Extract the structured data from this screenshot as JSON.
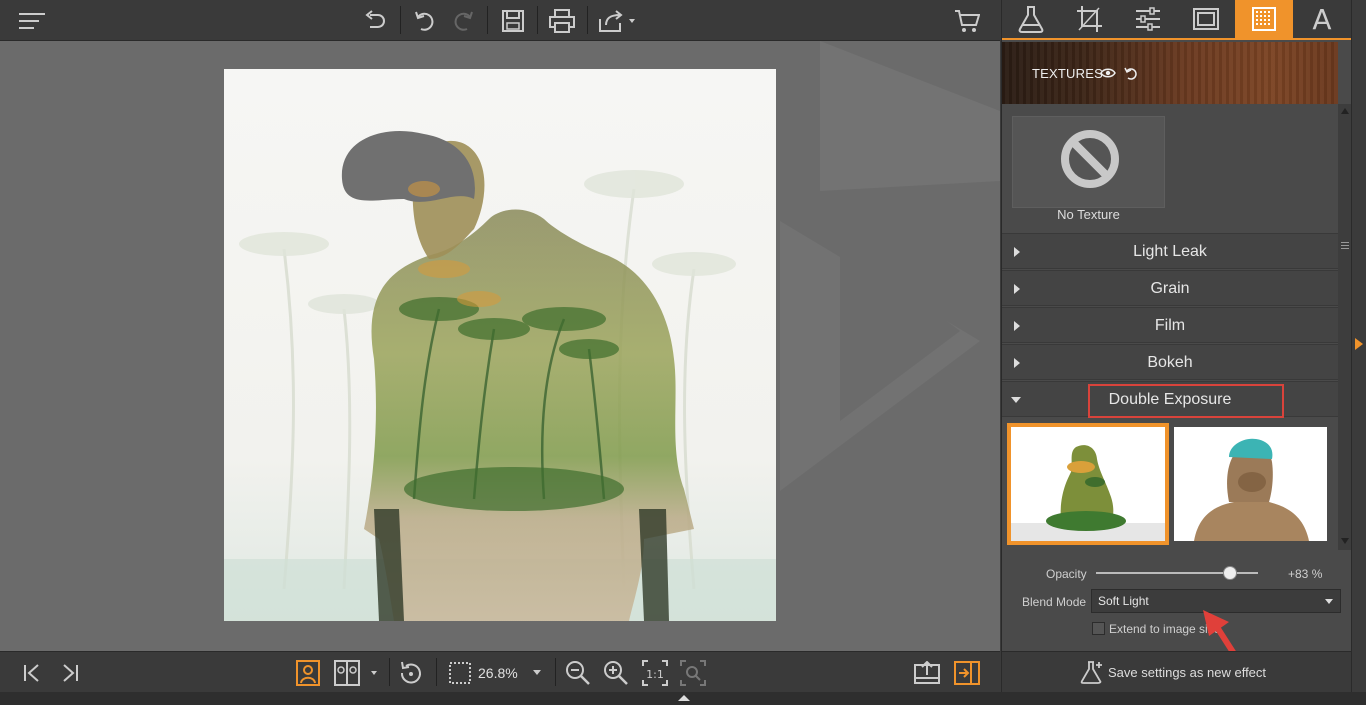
{
  "toolbar": {
    "menu_icon": "hamburger-menu-icon",
    "buttons": [
      "undo-all-icon",
      "undo-icon",
      "redo-icon",
      "save-icon",
      "print-icon",
      "share-icon",
      "cart-icon"
    ]
  },
  "bottom_bar": {
    "zoom_value": "26.8%"
  },
  "right_panel": {
    "tabs": [
      {
        "name": "effects-tab",
        "icon": "flask-icon"
      },
      {
        "name": "crop-tab",
        "icon": "crop-icon"
      },
      {
        "name": "adjust-tab",
        "icon": "sliders-icon"
      },
      {
        "name": "frames-tab",
        "icon": "frame-icon"
      },
      {
        "name": "textures-tab",
        "icon": "texture-grid-icon",
        "active": true
      },
      {
        "name": "text-tab",
        "label": "A"
      }
    ],
    "textures_title": "TEXTURES",
    "no_texture_label": "No Texture",
    "sections": [
      {
        "label": "Light Leak",
        "expanded": false
      },
      {
        "label": "Grain",
        "expanded": false
      },
      {
        "label": "Film",
        "expanded": false
      },
      {
        "label": "Bokeh",
        "expanded": false
      },
      {
        "label": "Double Exposure",
        "expanded": true
      }
    ],
    "opacity_label": "Opacity",
    "opacity_value": "+83 %",
    "opacity_level": 0.83,
    "blend_mode_label": "Blend Mode",
    "blend_mode_value": "Soft Light",
    "extend_label": "Extend to image size",
    "save_label": "Save settings as new effect"
  },
  "colors": {
    "accent": "#f0932b",
    "highlight": "#d9433b"
  }
}
